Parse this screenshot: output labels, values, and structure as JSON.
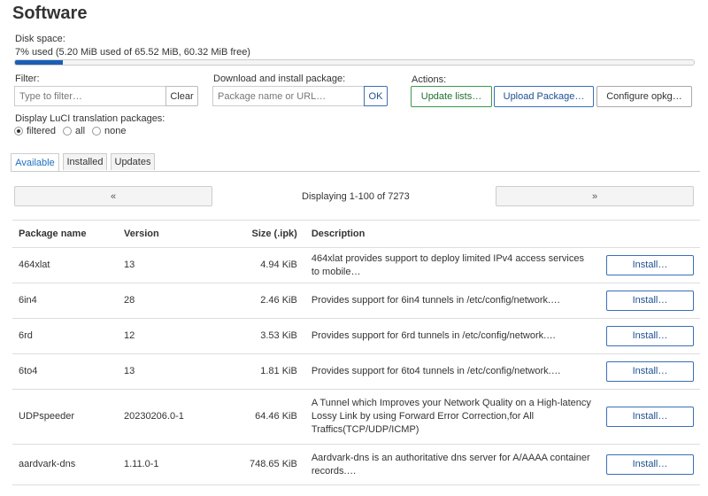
{
  "page": {
    "title": "Software"
  },
  "disk": {
    "label": "Disk space:",
    "text": "7% used (5.20 MiB used of 65.52 MiB, 60.32 MiB free)",
    "percent": 7
  },
  "filter": {
    "label": "Filter:",
    "placeholder": "Type to filter…",
    "clear_label": "Clear"
  },
  "download": {
    "label": "Download and install package:",
    "placeholder": "Package name or URL…",
    "ok_label": "OK"
  },
  "actions": {
    "label": "Actions:",
    "update_lists": "Update lists…",
    "upload_package": "Upload Package…",
    "configure": "Configure opkg…"
  },
  "luci": {
    "label": "Display LuCI translation packages:",
    "options": [
      "filtered",
      "all",
      "none"
    ],
    "selected": "filtered"
  },
  "tabs": [
    "Available",
    "Installed",
    "Updates"
  ],
  "pager": {
    "prev": "«",
    "next": "»",
    "text": "Displaying 1-100 of 7273"
  },
  "table": {
    "headers": [
      "Package name",
      "Version",
      "Size (.ipk)",
      "Description"
    ],
    "install_label": "Install…",
    "rows": [
      {
        "name": "464xlat",
        "version": "13",
        "size": "4.94 KiB",
        "desc": "464xlat provides support to deploy limited IPv4 access services to mobile…"
      },
      {
        "name": "6in4",
        "version": "28",
        "size": "2.46 KiB",
        "desc": "Provides support for 6in4 tunnels in /etc/config/network.…"
      },
      {
        "name": "6rd",
        "version": "12",
        "size": "3.53 KiB",
        "desc": "Provides support for 6rd tunnels in /etc/config/network.…"
      },
      {
        "name": "6to4",
        "version": "13",
        "size": "1.81 KiB",
        "desc": "Provides support for 6to4 tunnels in /etc/config/network.…"
      },
      {
        "name": "UDPspeeder",
        "version": "20230206.0-1",
        "size": "64.46 KiB",
        "desc": "A Tunnel which Improves your Network Quality on a High-latency Lossy Link by using Forward Error Correction,for All Traffics(TCP/UDP/ICMP)"
      },
      {
        "name": "aardvark-dns",
        "version": "1.11.0-1",
        "size": "748.65 KiB",
        "desc": "Aardvark-dns is an authoritative dns server for A/AAAA container records.…"
      }
    ]
  }
}
